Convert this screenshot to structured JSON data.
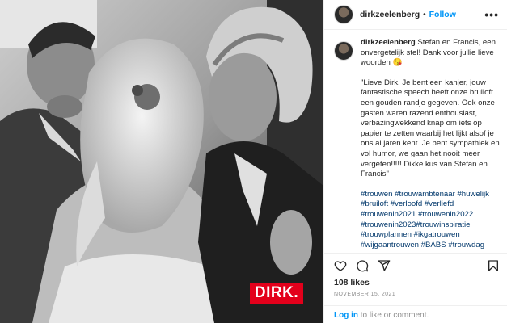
{
  "post": {
    "username": "dirkzeelenberg",
    "follow_label": "Follow",
    "header_separator": "•",
    "more_label": "•••",
    "photo_logo": "DIRK.",
    "caption_lines": [
      "Stefan en Francis, een onvergetelijk stel! Dank voor jullie lieve woorden 😘",
      "\"Lieve Dirk, Je bent een kanjer, jouw fantastische speech heeft onze bruiloft een gouden randje gegeven. Ook onze gasten waren razend enthousiast, verbazingwekkend knap om iets op papier te zetten waarbij het lijkt alsof je ons al jaren kent. Je bent sympathiek en vol humor, we gaan het nooit meer vergeten!!!!! Dikke kus van Stefan en Francis\"",
      "#trouwen #trouwambtenaar #huwelijk #bruiloft #verloofd #verliefd #trouwenin2021 #trouwenin2022 #trouwenin2023#trouwinspiratie #trouwplannen #ikgatrouwen #wijgaantrouwen #BABS #trouwdag"
    ],
    "likes": "108 likes",
    "date": "NOVEMBER 15, 2021",
    "login_link": "Log in",
    "login_text": " to like or comment."
  },
  "icons": {
    "like": "heart-icon",
    "comment": "comment-icon",
    "share": "share-icon",
    "save": "bookmark-icon",
    "more": "more-icon"
  },
  "colors": {
    "link_blue": "#0095f6",
    "hashtag": "#00376b",
    "logo_red": "#e3001b"
  }
}
